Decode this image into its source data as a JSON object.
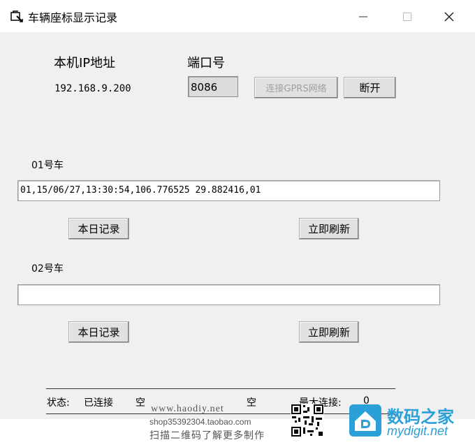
{
  "window": {
    "title": "车辆座标显示记录",
    "controls": {
      "minimize": "—",
      "maximize": "☐",
      "close": "✕"
    }
  },
  "network": {
    "ip_label": "本机IP地址",
    "ip_value": "192.168.9.200",
    "port_label": "端口号",
    "port_value": "8086",
    "connect_button": "连接GPRS网络",
    "disconnect_button": "断开"
  },
  "vehicles": [
    {
      "label": "01号车",
      "value": "01,15/06/27,13:30:54,106.776525 29.882416,01",
      "records_button": "本日记录",
      "refresh_button": "立即刷新"
    },
    {
      "label": "02号车",
      "value": "",
      "records_button": "本日记录",
      "refresh_button": "立即刷新"
    }
  ],
  "status_bar": {
    "state_label": "状态:",
    "state_value": "已连接",
    "empty1": "空",
    "empty2": "空",
    "max_label": "最大连接:",
    "max_value": "0"
  },
  "watermark": {
    "site": "www.haodiy.net",
    "shop": "shop35392304.taobao.com",
    "caption": "扫描二维码了解更多制作",
    "brand_cn": "数码之家",
    "brand_url": "mydigit.net",
    "colors": {
      "brand": "#2a9fd8"
    }
  }
}
